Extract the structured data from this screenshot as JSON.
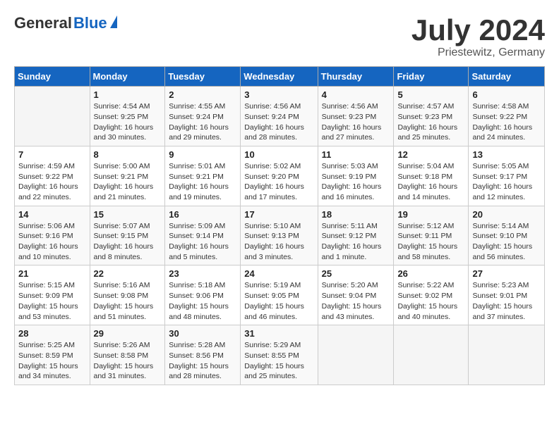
{
  "header": {
    "logo_general": "General",
    "logo_blue": "Blue",
    "title": "July 2024",
    "location": "Priestewitz, Germany"
  },
  "columns": [
    "Sunday",
    "Monday",
    "Tuesday",
    "Wednesday",
    "Thursday",
    "Friday",
    "Saturday"
  ],
  "weeks": [
    [
      {
        "num": "",
        "info": ""
      },
      {
        "num": "1",
        "info": "Sunrise: 4:54 AM\nSunset: 9:25 PM\nDaylight: 16 hours\nand 30 minutes."
      },
      {
        "num": "2",
        "info": "Sunrise: 4:55 AM\nSunset: 9:24 PM\nDaylight: 16 hours\nand 29 minutes."
      },
      {
        "num": "3",
        "info": "Sunrise: 4:56 AM\nSunset: 9:24 PM\nDaylight: 16 hours\nand 28 minutes."
      },
      {
        "num": "4",
        "info": "Sunrise: 4:56 AM\nSunset: 9:23 PM\nDaylight: 16 hours\nand 27 minutes."
      },
      {
        "num": "5",
        "info": "Sunrise: 4:57 AM\nSunset: 9:23 PM\nDaylight: 16 hours\nand 25 minutes."
      },
      {
        "num": "6",
        "info": "Sunrise: 4:58 AM\nSunset: 9:22 PM\nDaylight: 16 hours\nand 24 minutes."
      }
    ],
    [
      {
        "num": "7",
        "info": "Sunrise: 4:59 AM\nSunset: 9:22 PM\nDaylight: 16 hours\nand 22 minutes."
      },
      {
        "num": "8",
        "info": "Sunrise: 5:00 AM\nSunset: 9:21 PM\nDaylight: 16 hours\nand 21 minutes."
      },
      {
        "num": "9",
        "info": "Sunrise: 5:01 AM\nSunset: 9:21 PM\nDaylight: 16 hours\nand 19 minutes."
      },
      {
        "num": "10",
        "info": "Sunrise: 5:02 AM\nSunset: 9:20 PM\nDaylight: 16 hours\nand 17 minutes."
      },
      {
        "num": "11",
        "info": "Sunrise: 5:03 AM\nSunset: 9:19 PM\nDaylight: 16 hours\nand 16 minutes."
      },
      {
        "num": "12",
        "info": "Sunrise: 5:04 AM\nSunset: 9:18 PM\nDaylight: 16 hours\nand 14 minutes."
      },
      {
        "num": "13",
        "info": "Sunrise: 5:05 AM\nSunset: 9:17 PM\nDaylight: 16 hours\nand 12 minutes."
      }
    ],
    [
      {
        "num": "14",
        "info": "Sunrise: 5:06 AM\nSunset: 9:16 PM\nDaylight: 16 hours\nand 10 minutes."
      },
      {
        "num": "15",
        "info": "Sunrise: 5:07 AM\nSunset: 9:15 PM\nDaylight: 16 hours\nand 8 minutes."
      },
      {
        "num": "16",
        "info": "Sunrise: 5:09 AM\nSunset: 9:14 PM\nDaylight: 16 hours\nand 5 minutes."
      },
      {
        "num": "17",
        "info": "Sunrise: 5:10 AM\nSunset: 9:13 PM\nDaylight: 16 hours\nand 3 minutes."
      },
      {
        "num": "18",
        "info": "Sunrise: 5:11 AM\nSunset: 9:12 PM\nDaylight: 16 hours\nand 1 minute."
      },
      {
        "num": "19",
        "info": "Sunrise: 5:12 AM\nSunset: 9:11 PM\nDaylight: 15 hours\nand 58 minutes."
      },
      {
        "num": "20",
        "info": "Sunrise: 5:14 AM\nSunset: 9:10 PM\nDaylight: 15 hours\nand 56 minutes."
      }
    ],
    [
      {
        "num": "21",
        "info": "Sunrise: 5:15 AM\nSunset: 9:09 PM\nDaylight: 15 hours\nand 53 minutes."
      },
      {
        "num": "22",
        "info": "Sunrise: 5:16 AM\nSunset: 9:08 PM\nDaylight: 15 hours\nand 51 minutes."
      },
      {
        "num": "23",
        "info": "Sunrise: 5:18 AM\nSunset: 9:06 PM\nDaylight: 15 hours\nand 48 minutes."
      },
      {
        "num": "24",
        "info": "Sunrise: 5:19 AM\nSunset: 9:05 PM\nDaylight: 15 hours\nand 46 minutes."
      },
      {
        "num": "25",
        "info": "Sunrise: 5:20 AM\nSunset: 9:04 PM\nDaylight: 15 hours\nand 43 minutes."
      },
      {
        "num": "26",
        "info": "Sunrise: 5:22 AM\nSunset: 9:02 PM\nDaylight: 15 hours\nand 40 minutes."
      },
      {
        "num": "27",
        "info": "Sunrise: 5:23 AM\nSunset: 9:01 PM\nDaylight: 15 hours\nand 37 minutes."
      }
    ],
    [
      {
        "num": "28",
        "info": "Sunrise: 5:25 AM\nSunset: 8:59 PM\nDaylight: 15 hours\nand 34 minutes."
      },
      {
        "num": "29",
        "info": "Sunrise: 5:26 AM\nSunset: 8:58 PM\nDaylight: 15 hours\nand 31 minutes."
      },
      {
        "num": "30",
        "info": "Sunrise: 5:28 AM\nSunset: 8:56 PM\nDaylight: 15 hours\nand 28 minutes."
      },
      {
        "num": "31",
        "info": "Sunrise: 5:29 AM\nSunset: 8:55 PM\nDaylight: 15 hours\nand 25 minutes."
      },
      {
        "num": "",
        "info": ""
      },
      {
        "num": "",
        "info": ""
      },
      {
        "num": "",
        "info": ""
      }
    ]
  ]
}
